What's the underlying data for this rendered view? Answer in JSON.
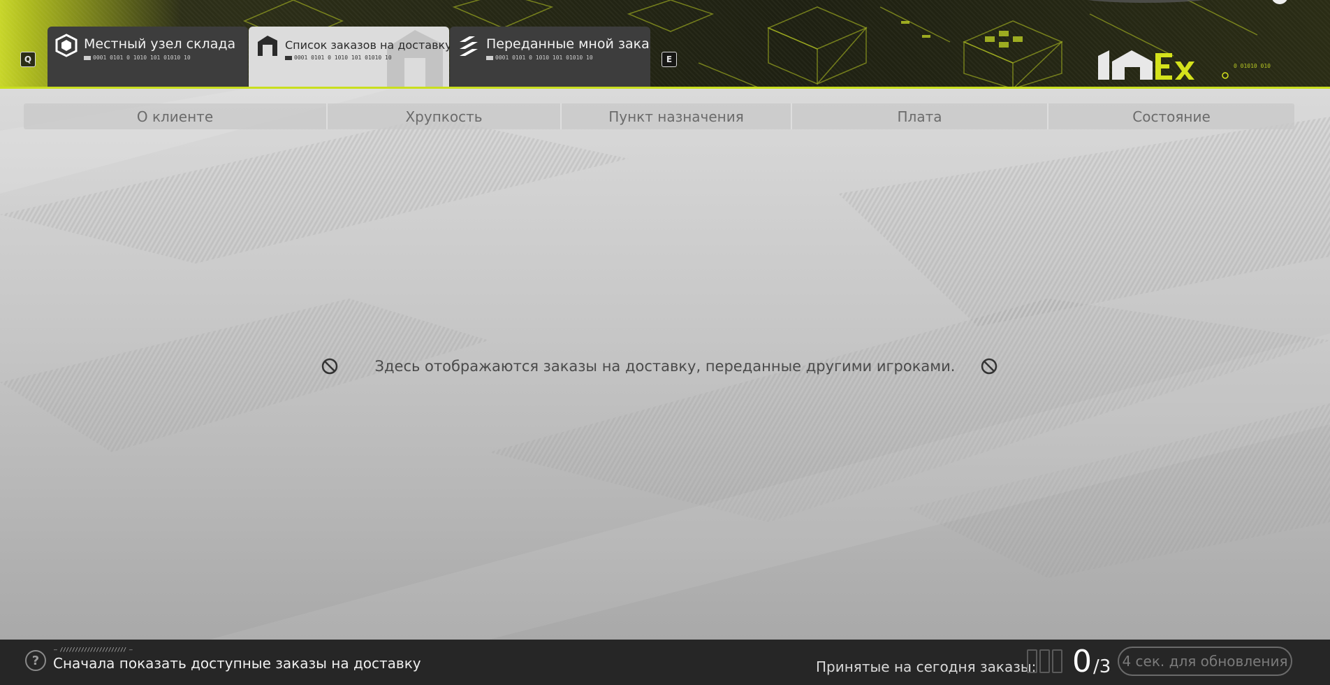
{
  "keys": {
    "prev": "Q",
    "next": "E"
  },
  "tabs": [
    {
      "label": "Местный узел склада",
      "code": "0001 0101 0 1010 101 01010 10",
      "icon": "warehouse-cube-icon",
      "active": false
    },
    {
      "label": "Список заказов на доставку",
      "code": "0001 0101 0 1010 101 01010 10",
      "icon": "delivery-list-icon",
      "active": true
    },
    {
      "label": "Переданные мной заказы",
      "code": "0001 0101 0 1010 101 01010 10",
      "icon": "handed-orders-icon",
      "active": false
    }
  ],
  "logo": {
    "code": "0 01010 010"
  },
  "columns": [
    {
      "label": "О клиенте"
    },
    {
      "label": "Хрупкость"
    },
    {
      "label": "Пункт назначения"
    },
    {
      "label": "Плата"
    },
    {
      "label": "Состояние"
    }
  ],
  "empty_message": "Здесь отображаются заказы на доставку, переданные другими игроками.",
  "footer": {
    "help_glyph": "?",
    "sub_code": "– ////////////////////// –",
    "hint": "Сначала показать доступные заказы на доставку",
    "accepted_label": "Принятые на сегодня заказы:",
    "accepted_count": "0",
    "accepted_max": "/3",
    "slots_total": 3,
    "refresh_label": "4 сек. для обновления"
  },
  "colors": {
    "accent": "#c9df1e",
    "tab_active": "#dcdcdc",
    "tab_inactive": "#3d3d3d",
    "footer": "#262626"
  }
}
